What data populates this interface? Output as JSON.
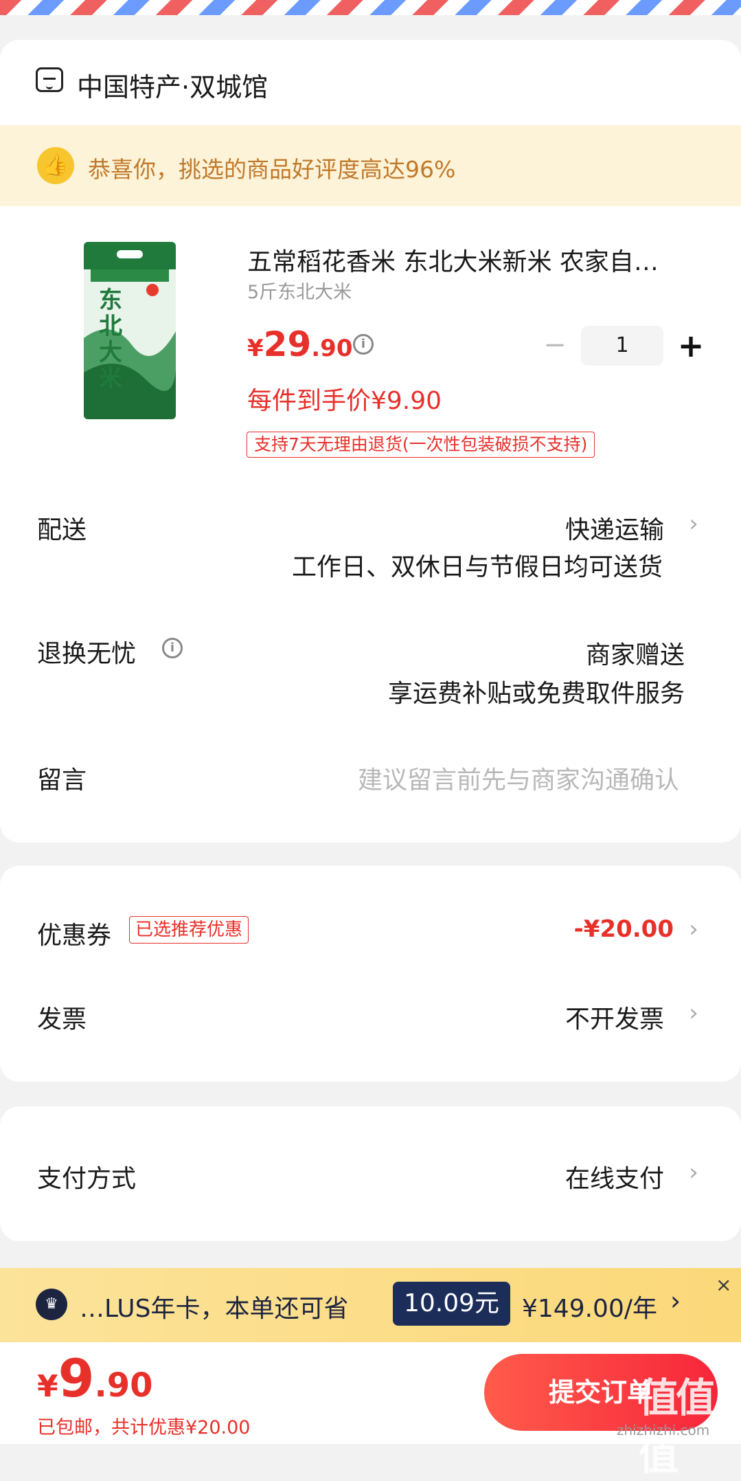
{
  "colors": {
    "accent_red": "#e8302a",
    "banner_text": "#c0792a",
    "plus_dark": "#1c2d5a"
  },
  "store": {
    "name": "中国特产·双城馆",
    "icon": "store-icon"
  },
  "banner": {
    "icon": "thumbs-up-icon",
    "text": "恭喜你，挑选的商品好评度高达96%"
  },
  "product": {
    "image_icon": "rice-bag-image",
    "image_text": "东北大米",
    "title": "五常稻花香米 东北大米新米 农家自…",
    "spec": "5斤东北大米",
    "price_currency": "¥",
    "price_int": "29",
    "price_dec": ".90",
    "price_info_icon": "info-icon",
    "quantity": "1",
    "minus_icon": "minus-icon",
    "plus_icon": "plus-icon",
    "hand_price": "每件到手价¥9.90",
    "return_tag": "支持7天无理由退货(一次性包装破损不支持)"
  },
  "delivery": {
    "label": "配送",
    "method": "快递运输",
    "note": "工作日、双休日与节假日均可送货"
  },
  "returns": {
    "label": "退换无忧",
    "value": "商家赠送",
    "note": "享运费补贴或免费取件服务"
  },
  "message": {
    "label": "留言",
    "placeholder": "建议留言前先与商家沟通确认"
  },
  "coupon": {
    "label": "优惠券",
    "tag": "已选推荐优惠",
    "value": "-¥20.00"
  },
  "invoice": {
    "label": "发票",
    "value": "不开发票"
  },
  "payment": {
    "label": "支付方式",
    "value": "在线支付"
  },
  "plus_bar": {
    "text": "…LUS年卡，本单还可省",
    "amount": "10.09元",
    "price": "¥149.00/年",
    "close": "×"
  },
  "footer": {
    "total_currency": "¥",
    "total_int": "9",
    "total_dec": ".90",
    "shipping_note": "已包邮，共计优惠¥20.00",
    "submit": "提交订单",
    "watermark": "值值值",
    "watermark_url": "zhizhizhi.com"
  }
}
